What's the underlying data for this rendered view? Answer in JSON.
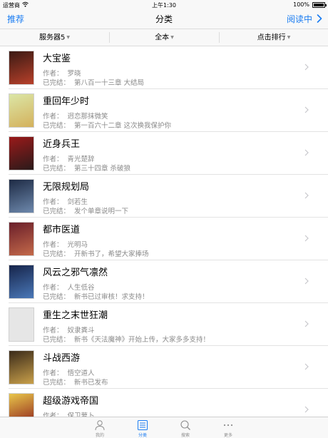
{
  "status_bar": {
    "carrier": "运营商",
    "time": "上午1:30",
    "battery": "100%"
  },
  "nav": {
    "left": "推荐",
    "title": "分类",
    "right": "阅读中"
  },
  "filters": [
    {
      "label": "服务器5"
    },
    {
      "label": "全本"
    },
    {
      "label": "点击排行"
    }
  ],
  "books": [
    {
      "title": "大宝鉴",
      "author_label": "作者：",
      "author": "罗晓",
      "status": "已完结：",
      "latest": "第八百一十三章 大结局",
      "cover_colors": [
        "#3a1a14",
        "#b8402a"
      ]
    },
    {
      "title": "重回年少时",
      "author_label": "作者：",
      "author": "迥恋那抹微笑",
      "status": "已完结：",
      "latest": "第一百六十二章 这次换我保护你",
      "cover_colors": [
        "#dbe6a6",
        "#d4b15c"
      ]
    },
    {
      "title": "近身兵王",
      "author_label": "作者：",
      "author": "青光楚辞",
      "status": "已完结：",
      "latest": "第三十四章 杀破狼",
      "cover_colors": [
        "#9a1a1a",
        "#2a1a1a"
      ]
    },
    {
      "title": "无限规划局",
      "author_label": "作者：",
      "author": "剑若生",
      "status": "已完结：",
      "latest": "发个单章说明一下",
      "cover_colors": [
        "#1d2a44",
        "#6e89ad"
      ]
    },
    {
      "title": "都市医道",
      "author_label": "作者：",
      "author": "光明马",
      "status": "已完结：",
      "latest": "开新书了，希望大家捧场",
      "cover_colors": [
        "#6a1e2a",
        "#c46a4a"
      ]
    },
    {
      "title": "风云之邪气凛然",
      "author_label": "作者：",
      "author": "人生低谷",
      "status": "已完结：",
      "latest": "新书已过审核！求支持！",
      "cover_colors": [
        "#16244a",
        "#4a78b8"
      ]
    },
    {
      "title": "重生之末世狂潮",
      "author_label": "作者：",
      "author": "奴隶粪斗",
      "status": "已完结：",
      "latest": "新书《天法魔神》开始上传，大家多多支持！",
      "cover_colors": [
        "#e6e6e6",
        "#e6e6e6"
      ]
    },
    {
      "title": "斗战西游",
      "author_label": "作者：",
      "author": "悟空道人",
      "status": "已完结：",
      "latest": "新书已发布",
      "cover_colors": [
        "#3a2a1a",
        "#c9a04a"
      ]
    },
    {
      "title": "超级游戏帝国",
      "author_label": "作者：",
      "author": "保卫萝卜",
      "status": "",
      "latest": "",
      "cover_colors": [
        "#e8c64a",
        "#8a1a1a"
      ]
    }
  ],
  "tabs": [
    {
      "label": "我的",
      "icon": "person-icon"
    },
    {
      "label": "分类",
      "icon": "list-icon"
    },
    {
      "label": "搜索",
      "icon": "search-icon"
    },
    {
      "label": "更多",
      "icon": "more-icon"
    }
  ],
  "colors": {
    "accent": "#1a7cf2",
    "bar_bg": "#f8f8f8",
    "meta_text": "#8a8a8a"
  }
}
